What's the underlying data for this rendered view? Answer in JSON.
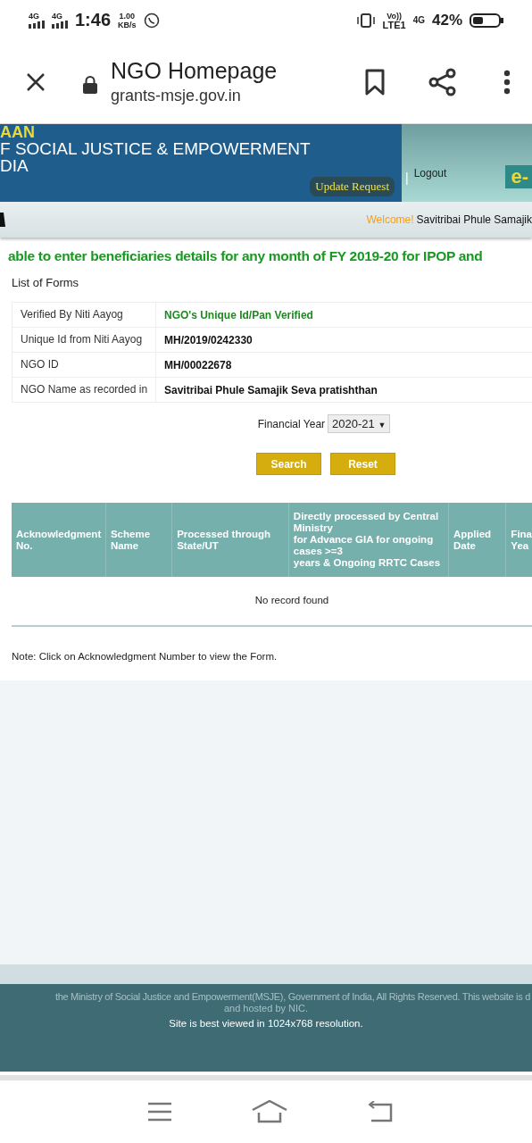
{
  "status_bar": {
    "signal_labels": [
      "4G",
      "4G"
    ],
    "time": "1:46",
    "speed": "1.00",
    "speed_unit": "KB/s",
    "volte": "Vo))",
    "lte": "LTE1",
    "network": "4G",
    "battery": "42%"
  },
  "browser": {
    "title": "NGO Homepage",
    "url": "grants-msje.gov.in"
  },
  "banner": {
    "logo_text": "AAN",
    "ministry_line": "F SOCIAL JUSTICE & EMPOWERMENT",
    "country_line": "DIA",
    "update_button": "Update Request",
    "separator": "|",
    "logout": "Logout",
    "badge": "e-"
  },
  "welcome_bar": {
    "greeting": "Welcome!",
    "user": "Savitribai Phule Samajik"
  },
  "notice": "able to enter beneficiaries details for any month of FY 2019-20 for IPOP and",
  "section_title": "List of Forms",
  "details": [
    {
      "label": "Verified By Niti Aayog",
      "value": "NGO's Unique Id/Pan Verified",
      "kind": "status"
    },
    {
      "label": "Unique Id from Niti Aayog",
      "value": "MH/2019/0242330",
      "kind": "plain"
    },
    {
      "label": "NGO ID",
      "value": "MH/00022678",
      "kind": "plain"
    },
    {
      "label": "NGO Name as recorded in",
      "value": "Savitribai Phule Samajik Seva pratishthan",
      "kind": "plain"
    }
  ],
  "filter": {
    "label": "Financial Year",
    "value": "2020-21",
    "caret": "▼"
  },
  "buttons": [
    "Search",
    "Reset"
  ],
  "results": {
    "columns": [
      "Acknowledgment No.",
      "Scheme Name",
      "Processed through State/UT",
      "Directly processed by Central Ministry\nfor Advance GIA for ongoing cases >=3\nyears & Ongoing RRTC Cases",
      "Applied Date",
      "Fina Yea"
    ],
    "empty_message": "No record found"
  },
  "note": "Note: Click on Acknowledgment Number to view the Form.",
  "footer": {
    "copyright": "the Ministry of Social Justice and Empowerment(MSJE), Government of India, All Rights Reserved. This website is d",
    "hosted": "and hosted by NIC.",
    "resolution": "Site is best viewed in 1024x768 resolution."
  }
}
